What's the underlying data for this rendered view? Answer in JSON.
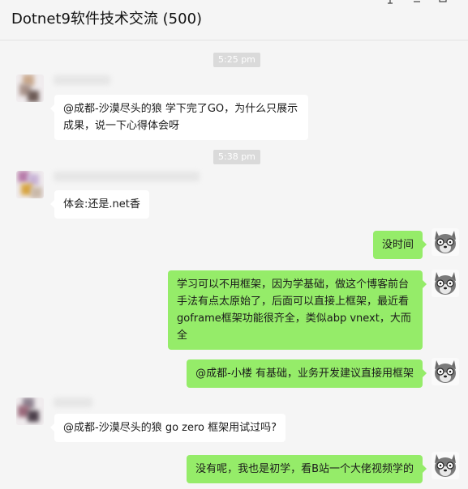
{
  "window": {
    "title": "Dotnet9软件技术交流 (500)"
  },
  "messages": [
    {
      "type": "time",
      "text": "5:25 pm"
    },
    {
      "type": "in",
      "text": "@成都-沙漠尽头的狼 学下完了GO，为什么只展示成果，说一下心得体会呀"
    },
    {
      "type": "time",
      "text": "5:38 pm"
    },
    {
      "type": "in",
      "text": "体会:还是.net香"
    },
    {
      "type": "out",
      "text": "没时间"
    },
    {
      "type": "out",
      "text": "学习可以不用框架，因为学基础，做这个博客前台手法有点太原始了，后面可以直接上框架，最近看goframe框架功能很齐全，类似abp vnext，大而全"
    },
    {
      "type": "out",
      "text": "@成都-小楼 有基础，业务开发建议直接用框架"
    },
    {
      "type": "in",
      "text": "@成都-沙漠尽头的狼  go zero 框架用试过吗?"
    },
    {
      "type": "out",
      "text": "没有呢，我也是初学，看B站一个大佬视频学的"
    }
  ],
  "colors": {
    "outgoing_bubble": "#95ec69",
    "incoming_bubble": "#ffffff",
    "background": "#f5f5f5",
    "timestamp_pill": "#dadada"
  }
}
